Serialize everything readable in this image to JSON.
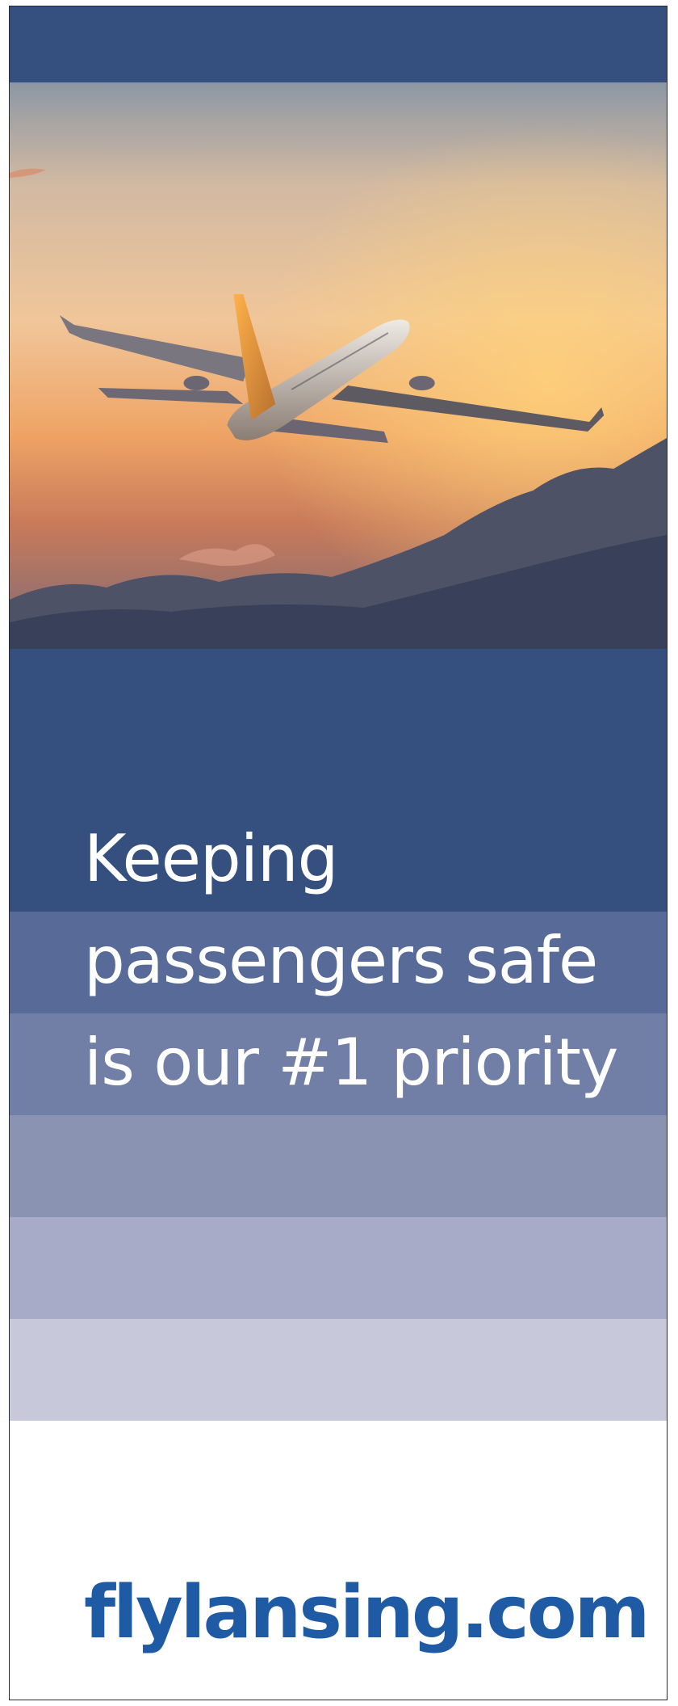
{
  "colors": {
    "navy": "#354f7f",
    "stripes": [
      "#586a98",
      "#717ea6",
      "#8b93b3",
      "#a7abc7",
      "#c7c9da"
    ],
    "url_blue": "#1f5ba4",
    "headline_text": "#ffffff"
  },
  "photo": {
    "subject": "airplane-taking-off-at-sunset"
  },
  "headline": {
    "line1": "Keeping",
    "line2": "passengers safe",
    "line3": "is our #1 priority"
  },
  "footer": {
    "url": "flylansing.com"
  }
}
